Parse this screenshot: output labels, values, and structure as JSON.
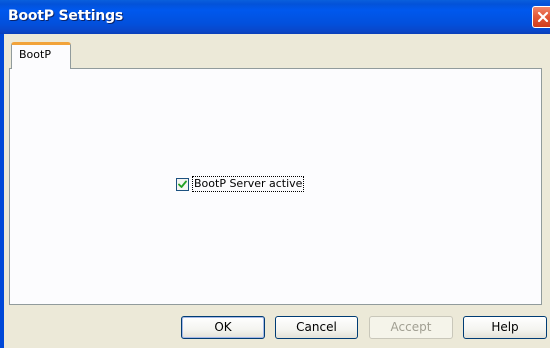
{
  "window": {
    "title": "BootP Settings"
  },
  "tabs": [
    {
      "label": "BootP",
      "selected": true
    }
  ],
  "bootp": {
    "server_active_label": "BootP Server active",
    "server_active_checked": true
  },
  "buttons": {
    "ok": "OK",
    "cancel": "Cancel",
    "accept": "Accept",
    "help": "Help"
  },
  "icons": {
    "close": "close-icon",
    "checkmark": "checkmark-icon"
  },
  "colors": {
    "titlebar": "#0058ee",
    "close_button": "#e35a3a",
    "tab_highlight": "#f2a33a",
    "checkmark": "#21a121"
  }
}
